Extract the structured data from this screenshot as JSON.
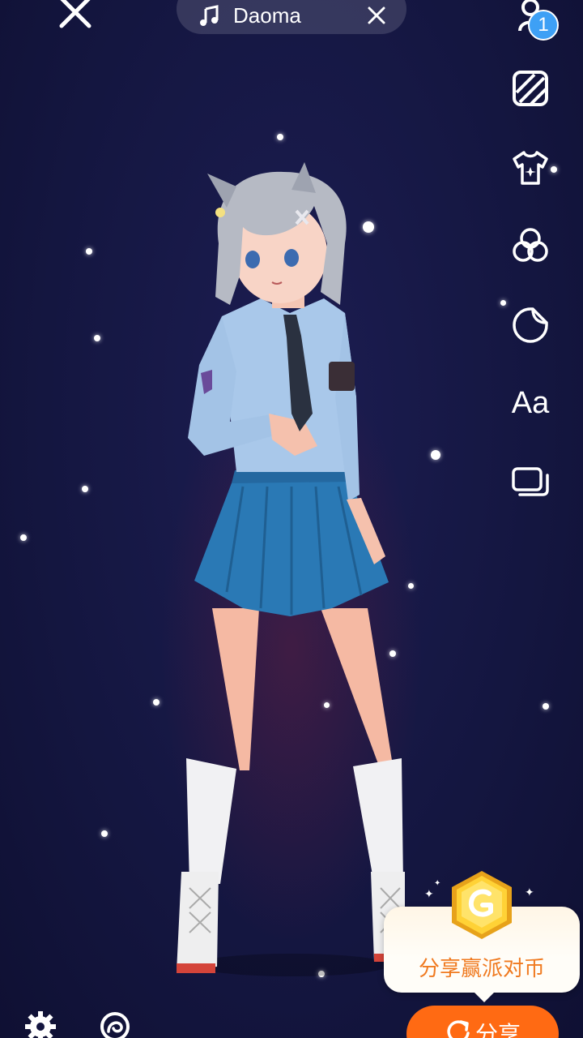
{
  "music": {
    "title": "Daoma"
  },
  "toolbar": {
    "badge_count": "1",
    "text_tool_label": "Aa",
    "tools": [
      "person-icon",
      "stripes-icon",
      "tshirt-icon",
      "filter-circles-icon",
      "sticker-icon",
      "text-icon",
      "layers-icon"
    ]
  },
  "promo": {
    "text": "分享赢派对币"
  },
  "share": {
    "label": "分享"
  },
  "colors": {
    "accent": "#ff6a13",
    "badge": "#3ea0f5",
    "background": "#141640"
  }
}
